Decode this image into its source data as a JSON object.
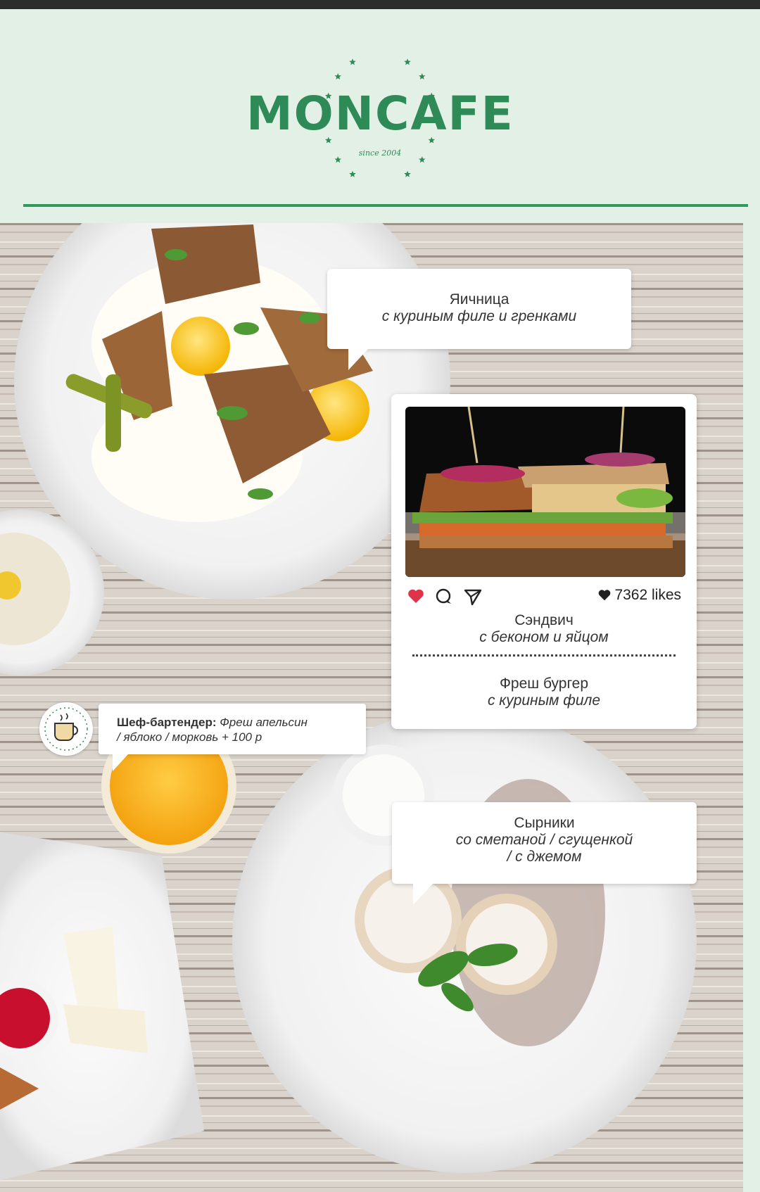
{
  "brand": {
    "name": "MONCAFE",
    "since": "since 2004",
    "color": "#2e8b57"
  },
  "callouts": {
    "eggs": {
      "title": "Яичница",
      "subtitle": "с куриным филе и гренками"
    },
    "chef": {
      "label": "Шеф-бартендер:",
      "text_line1": "Фреш апельсин",
      "text_line2": "/ яблоко / морковь + 100 р"
    },
    "syrniki": {
      "title": "Сырники",
      "subtitle_line1": "со сметаной / сгущенкой",
      "subtitle_line2": "/ с джемом"
    }
  },
  "post": {
    "likes": "7362 likes",
    "items": [
      {
        "title": "Сэндвич",
        "subtitle": "с беконом и яйцом"
      },
      {
        "title": "Фреш бургер",
        "subtitle": "с куриным филе"
      }
    ],
    "icons": [
      "heart-icon",
      "comment-icon",
      "share-icon"
    ],
    "like_color": "#e0334a"
  }
}
